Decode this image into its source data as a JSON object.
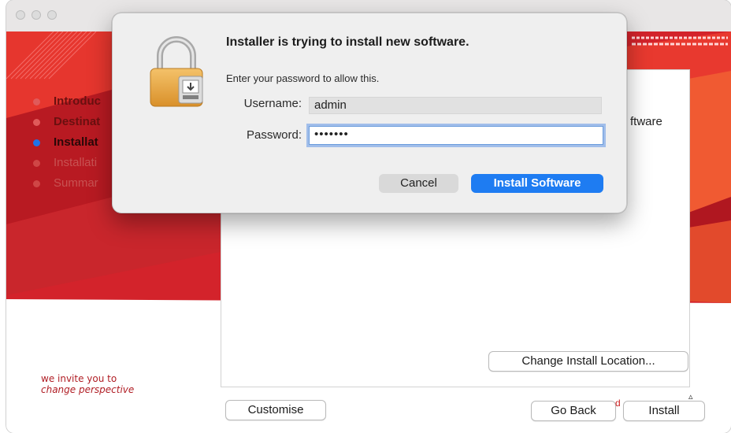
{
  "window": {
    "titlebar_buttons": [
      "close",
      "minimize",
      "zoom"
    ]
  },
  "sidebar": {
    "steps": [
      {
        "label": "Introduc",
        "state": "done"
      },
      {
        "label": "Destinat",
        "state": "done"
      },
      {
        "label": "Installat",
        "state": "current"
      },
      {
        "label": "Installati",
        "state": "future"
      },
      {
        "label": "Summar",
        "state": "future"
      }
    ],
    "tagline_line1": "we invite you to",
    "tagline_line2": "change perspective"
  },
  "main": {
    "partial_text": "ftware",
    "change_location_label": "Change Install Location...",
    "customise_label": "Customise",
    "go_back_label": "Go Back",
    "install_label": "Install",
    "partial_char": "d"
  },
  "dialog": {
    "title": "Installer is trying to install new software.",
    "message": "Enter your password to allow this.",
    "username_label": "Username:",
    "username_value": "admin",
    "password_label": "Password:",
    "password_value": "•••••••",
    "cancel_label": "Cancel",
    "confirm_label": "Install Software",
    "icon": "lock-icon"
  },
  "colors": {
    "accent": "#1e7cf2",
    "brand_red": "#d01f2a",
    "current_step": "#1f72e8"
  }
}
